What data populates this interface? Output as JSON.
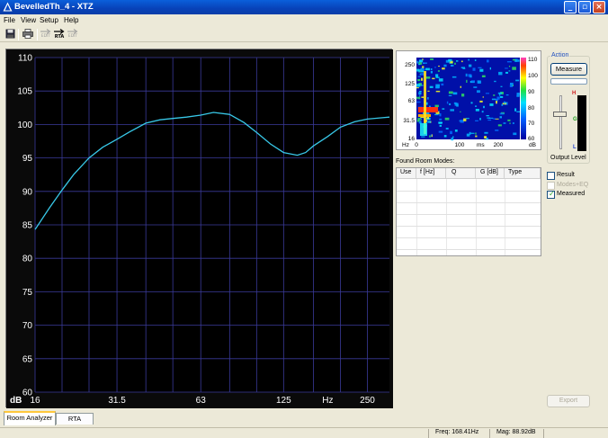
{
  "window": {
    "title": "BevelledTh_4 - XTZ"
  },
  "menu": [
    "File",
    "View",
    "Setup",
    "Help"
  ],
  "toolbar": {
    "rta_label": "RTA",
    "small1": "EDIT",
    "small2": "EDIT"
  },
  "chart_data": {
    "type": "line",
    "title": "",
    "xlabel": "Hz",
    "ylabel": "dB",
    "x_scale": "log",
    "xlim": [
      16,
      300
    ],
    "ylim": [
      60,
      110
    ],
    "x_ticks": [
      "16",
      "31.5",
      "63",
      "125",
      "Hz",
      "250"
    ],
    "x_tick_values": [
      16,
      31.5,
      63,
      125,
      null,
      250
    ],
    "y_ticks": [
      60,
      65,
      70,
      75,
      80,
      85,
      90,
      95,
      100,
      105,
      110
    ],
    "grid": true,
    "line_color": "#38c8e8",
    "series": [
      {
        "x": [
          16,
          18,
          20,
          22,
          25,
          28,
          31.5,
          35,
          40,
          45,
          50,
          56,
          63,
          70,
          80,
          90,
          100,
          112,
          125,
          140,
          150,
          160,
          180,
          200,
          225,
          250,
          280,
          300
        ],
        "y": [
          84.3,
          87.5,
          90.2,
          92.5,
          95,
          96.6,
          97.8,
          98.9,
          100.2,
          100.7,
          100.9,
          101.1,
          101.4,
          101.8,
          101.5,
          100.3,
          98.8,
          97.1,
          95.8,
          95.4,
          95.8,
          96.8,
          98.2,
          99.6,
          100.4,
          100.8,
          101.0,
          101.1
        ]
      }
    ]
  },
  "waterfall": {
    "y_ticks": [
      "250",
      "125",
      "63",
      "31.5",
      "16"
    ],
    "y_unit": "Hz",
    "x_ticks": [
      "0",
      "100",
      "200"
    ],
    "x_unit": "ms",
    "colorbar_ticks": [
      "110",
      "100",
      "90",
      "80",
      "70",
      "60"
    ],
    "colorbar_unit": "dB"
  },
  "modes": {
    "label": "Found Room Modes:",
    "columns": [
      "Use",
      "f [Hz]",
      "Q",
      "G [dB]",
      "Type"
    ]
  },
  "action": {
    "group_label": "Action",
    "measure_button": "Measure",
    "output_level_label": "Output Level",
    "meter_mark_top": "H",
    "meter_mark_bottom": "L"
  },
  "checkboxes": [
    {
      "label": "Result",
      "checked": false,
      "enabled": true
    },
    {
      "label": "Modes+EQ",
      "checked": false,
      "enabled": false
    },
    {
      "label": "Measured",
      "checked": true,
      "enabled": true
    }
  ],
  "export_button": "Export",
  "tabs": [
    "Room Analyzer",
    "RTA"
  ],
  "status": {
    "freq": "Freq: 168.41Hz",
    "mag": "Mag: 88.92dB"
  }
}
